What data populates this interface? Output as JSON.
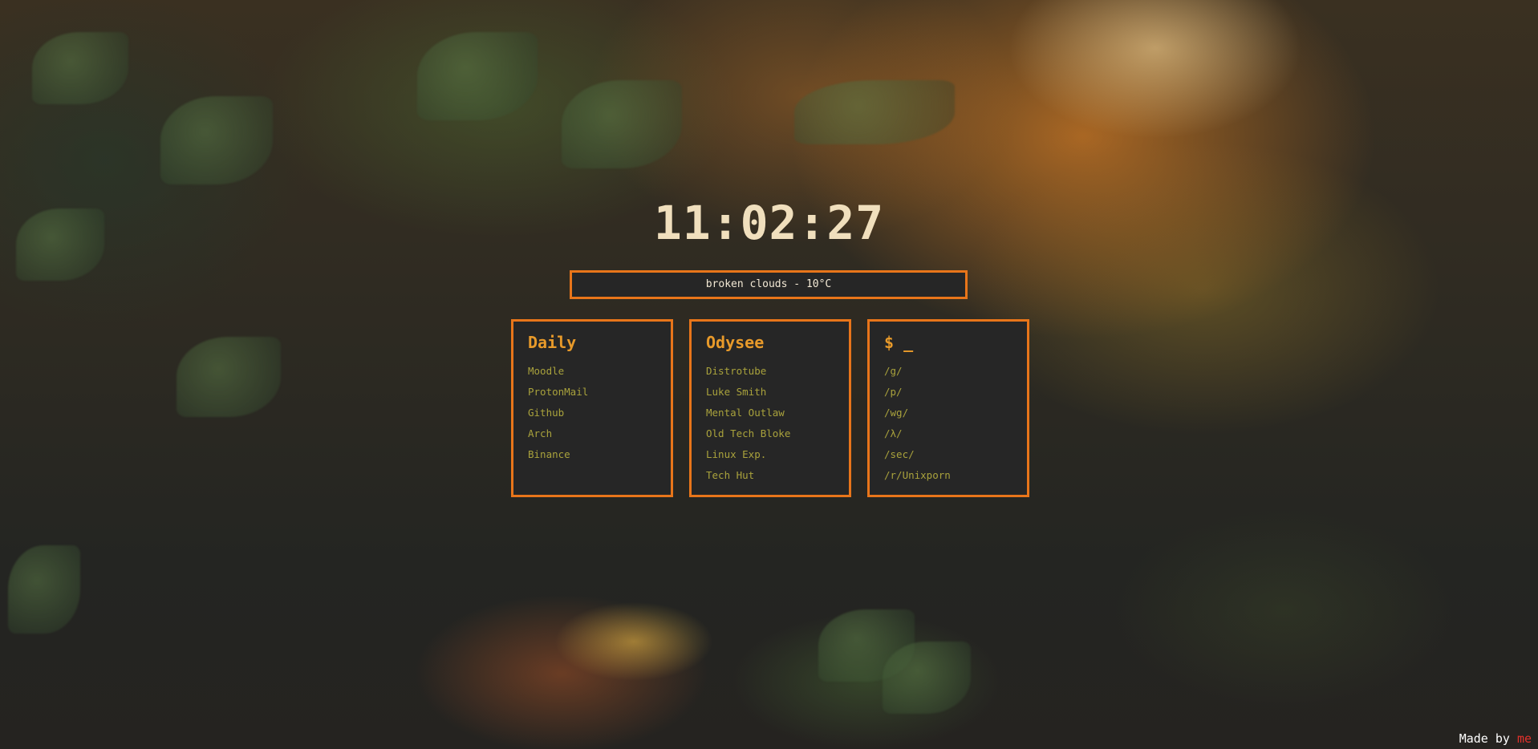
{
  "clock": {
    "time": "11:02:27"
  },
  "weather": {
    "text": "broken clouds - 10°C"
  },
  "cards": [
    {
      "title": "Daily",
      "links": [
        "Moodle",
        "ProtonMail",
        "Github",
        "Arch",
        "Binance"
      ]
    },
    {
      "title": "Odysee",
      "links": [
        "Distrotube",
        "Luke Smith",
        "Mental Outlaw",
        "Old Tech Bloke",
        "Linux Exp.",
        "Tech Hut"
      ]
    },
    {
      "title": "$ _",
      "links": [
        "/g/",
        "/p/",
        "/wg/",
        "/λ/",
        "/sec/",
        "/r/Unixporn"
      ]
    }
  ],
  "footer": {
    "prefix": "Made by ",
    "link": "me"
  },
  "colors": {
    "accent": "#e8751a",
    "card_bg": "#262626",
    "title": "#e89a2a",
    "link": "#a9a23c",
    "clock": "#f0dfbd",
    "footer_link": "#e3312b"
  }
}
